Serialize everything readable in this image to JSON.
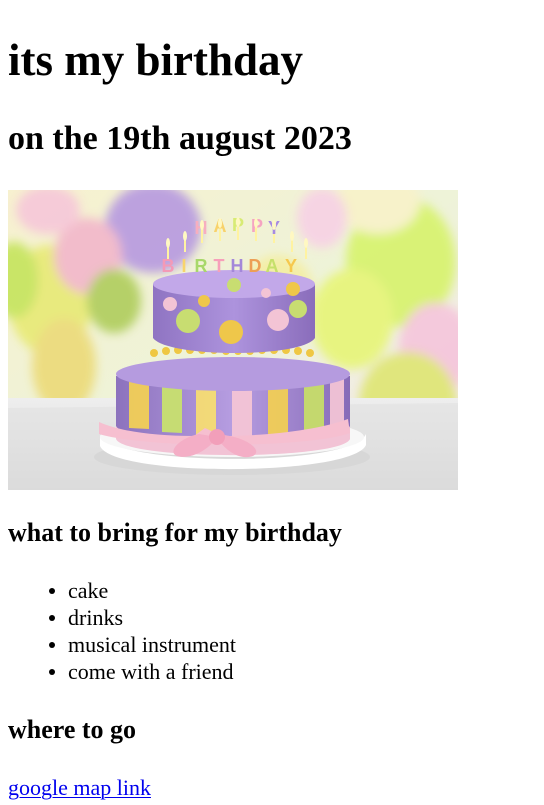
{
  "heading": "its my birthday",
  "date_heading": "on the 19th august 2023",
  "cake_image": {
    "alt": "Happy Birthday cake",
    "candles": [
      "H",
      "A",
      "P",
      "P",
      "Y",
      "B",
      "I",
      "R",
      "T",
      "H",
      "D",
      "A",
      "Y"
    ]
  },
  "bring": {
    "title": "what to bring for my birthday",
    "items": [
      "cake",
      "drinks",
      "musical instrument",
      "come with a friend"
    ]
  },
  "where": {
    "title": "where to go",
    "link_text": "google map link"
  },
  "colors": {
    "text": "#000000",
    "link": "#0000ee",
    "background": "#ffffff"
  }
}
